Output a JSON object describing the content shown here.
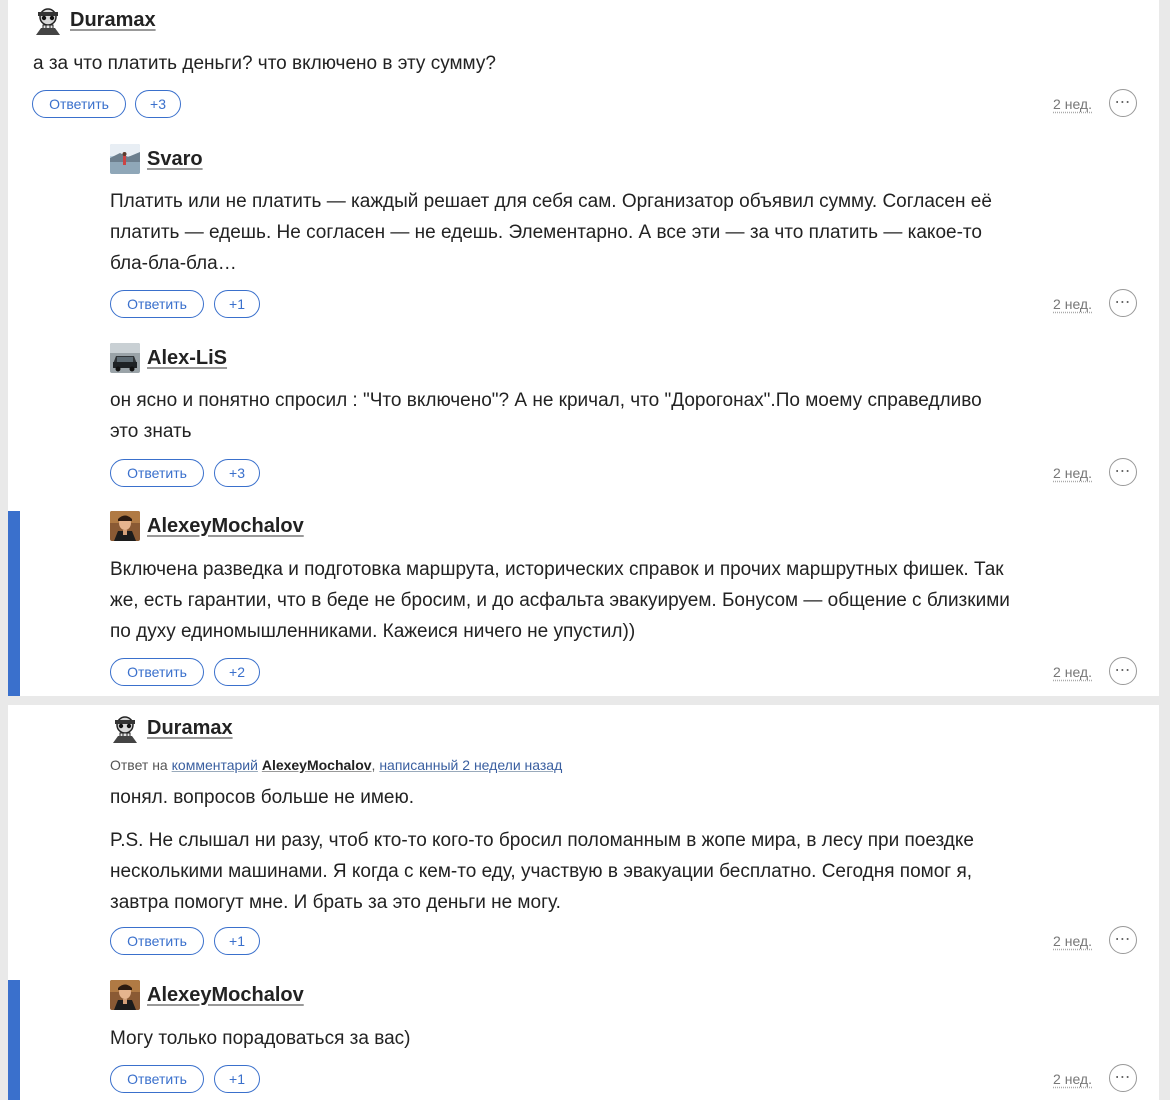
{
  "labels": {
    "reply": "Ответить",
    "more": "⋯",
    "reply_prefix": "Ответ на",
    "comment_link": "комментарий",
    "written_link": "написанный 2 недели назад"
  },
  "comments": [
    {
      "author": "Duramax",
      "text": [
        "а за что платить деньги? что включено в эту сумму?"
      ],
      "votes": "+3",
      "time": "2 нед."
    },
    {
      "author": "Svaro",
      "text": [
        "Платить или не платить — каждый решает для себя сам. Организатор объявил сумму. Согласен её платить — едешь. Не согласен — не едешь. Элементарно. А все эти — за что платить — какое-то бла-бла-бла…"
      ],
      "votes": "+1",
      "time": "2 нед."
    },
    {
      "author": "Alex-LiS",
      "text": [
        "он ясно и понятно спросил : \"Что включено\"? А не кричал, что \"Дорогонах\".По моему справедливо это знать"
      ],
      "votes": "+3",
      "time": "2 нед."
    },
    {
      "author": "AlexeyMochalov",
      "text": [
        "Включена разведка и подготовка маршрута, исторических справок и прочих маршрутных фишек. Так же, есть гарантии, что в беде не бросим, и до асфальта эвакуируем. Бонусом — общение с близкими по духу единомышленниками. Кажеися ничего не упустил))"
      ],
      "votes": "+2",
      "time": "2 нед."
    },
    {
      "author": "Duramax",
      "reply_to": "AlexeyMochalov",
      "text": [
        "понял. вопросов больше не имею.",
        "P.S. Не слышал ни разу, чтоб кто-то кого-то бросил поломанным в жопе мира, в лесу при поездке несколькими машинами. Я когда с кем-то еду, участвую в эвакуации бесплатно. Сегодня помог я, завтра помогут мне. И брать за это деньги не могу."
      ],
      "votes": "+1",
      "time": "2 нед."
    },
    {
      "author": "AlexeyMochalov",
      "text": [
        "Могу только порадоваться за вас)"
      ],
      "votes": "+1",
      "time": "2 нед."
    }
  ]
}
